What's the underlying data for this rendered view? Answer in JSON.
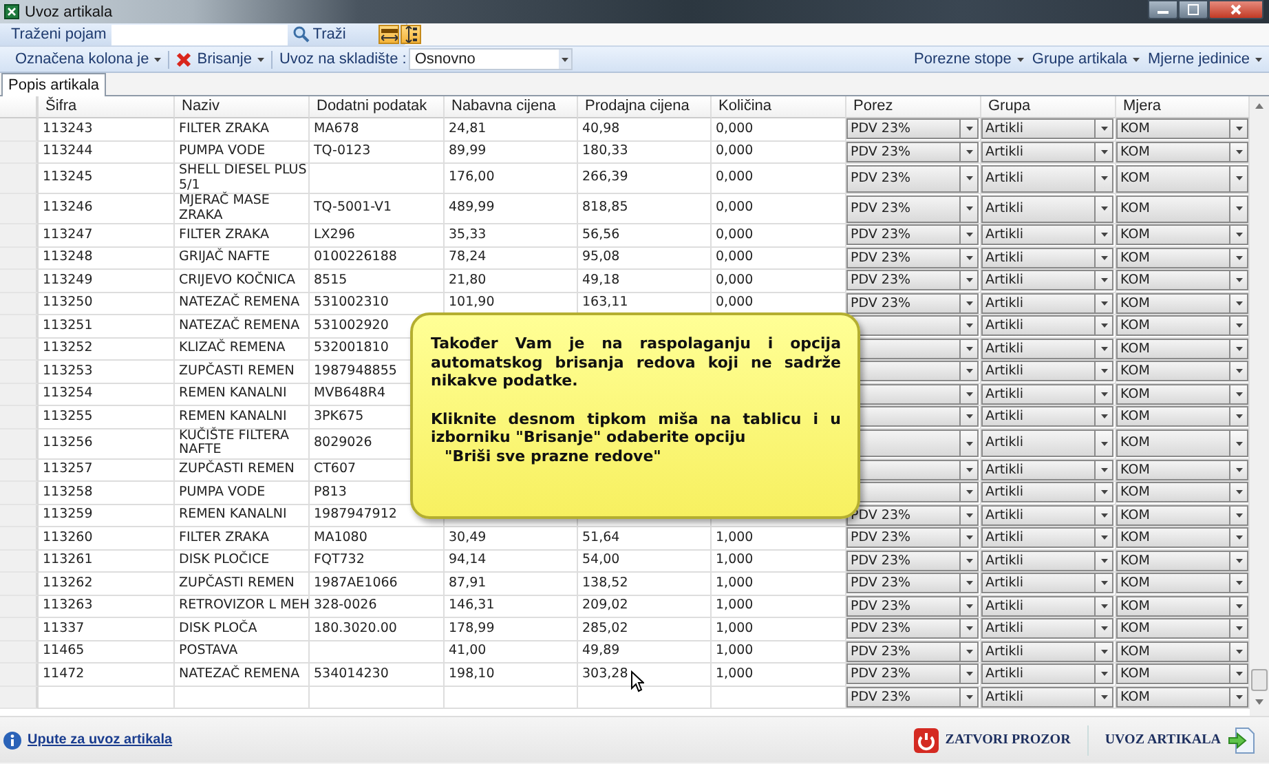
{
  "window": {
    "title": "Uvoz artikala"
  },
  "search_bar": {
    "label": "Traženi pojam",
    "button": "Traži"
  },
  "toolbar": {
    "menus": [
      "Označena kolona je",
      "Brisanje"
    ],
    "warehouse": {
      "label": "Uvoz na skladište :",
      "value": "Osnovno"
    },
    "right_menus": [
      "Porezne stope",
      "Grupe artikala",
      "Mjerne jedinice"
    ]
  },
  "tabs": [
    {
      "label": "Popis artikala",
      "selected": true
    }
  ],
  "table": {
    "columns": [
      {
        "label": "Šifra",
        "kind": "text"
      },
      {
        "label": "Naziv",
        "kind": "text"
      },
      {
        "label": "Dodatni podatak",
        "kind": "text"
      },
      {
        "label": "Nabavna cijena",
        "kind": "text"
      },
      {
        "label": "Prodajna cijena",
        "kind": "text"
      },
      {
        "label": "Količina",
        "kind": "text"
      },
      {
        "label": "Porez",
        "kind": "combo"
      },
      {
        "label": "Grupa",
        "kind": "combo"
      },
      {
        "label": "Mjera",
        "kind": "combo"
      }
    ],
    "rows": [
      {
        "sifra": "113243",
        "naziv": "FILTER ZRAKA",
        "dodatni_podatak": "MA678",
        "nabavna_cijena": "24,81",
        "prodajna_cijena": "40,98",
        "kolicina": "0,000",
        "porez": "PDV 23%",
        "grupa": "Artikli",
        "mjera": "KOM"
      },
      {
        "sifra": "113244",
        "naziv": "PUMPA VODE",
        "dodatni_podatak": "TQ-0123",
        "nabavna_cijena": "89,99",
        "prodajna_cijena": "180,33",
        "kolicina": "0,000",
        "porez": "PDV 23%",
        "grupa": "Artikli",
        "mjera": "KOM"
      },
      {
        "sifra": "113245",
        "naziv": "SHELL DIESEL PLUS\n5/1",
        "nabavna_cijena": "176,00",
        "prodajna_cijena": "266,39",
        "kolicina": "0,000",
        "porez": "PDV 23%",
        "grupa": "Artikli",
        "mjera": "KOM"
      },
      {
        "sifra": "113246",
        "naziv": "MJERAČ MASE\nZRAKA",
        "dodatni_podatak": "TQ-5001-V1",
        "nabavna_cijena": "489,99",
        "prodajna_cijena": "818,85",
        "kolicina": "0,000",
        "porez": "PDV 23%",
        "grupa": "Artikli",
        "mjera": "KOM"
      },
      {
        "sifra": "113247",
        "naziv": "FILTER ZRAKA",
        "dodatni_podatak": "LX296",
        "nabavna_cijena": "35,33",
        "prodajna_cijena": "56,56",
        "kolicina": "0,000",
        "porez": "PDV 23%",
        "grupa": "Artikli",
        "mjera": "KOM"
      },
      {
        "sifra": "113248",
        "naziv": "GRIJAČ NAFTE",
        "dodatni_podatak": "0100226188",
        "nabavna_cijena": "78,24",
        "prodajna_cijena": "95,08",
        "kolicina": "0,000",
        "porez": "PDV 23%",
        "grupa": "Artikli",
        "mjera": "KOM"
      },
      {
        "sifra": "113249",
        "naziv": "CRIJEVO KOČNICA",
        "dodatni_podatak": "8515",
        "nabavna_cijena": "21,80",
        "prodajna_cijena": "49,18",
        "kolicina": "0,000",
        "porez": "PDV 23%",
        "grupa": "Artikli",
        "mjera": "KOM"
      },
      {
        "sifra": "113250",
        "naziv": "NATEZAČ REMENA",
        "dodatni_podatak": "531002310",
        "nabavna_cijena": "101,90",
        "prodajna_cijena": "163,11",
        "kolicina": "0,000",
        "porez": "PDV 23%",
        "grupa": "Artikli",
        "mjera": "KOM"
      },
      {
        "sifra": "113251",
        "naziv": "NATEZAČ REMENA",
        "dodatni_podatak": "531002920",
        "grupa": "Artikli",
        "mjera": "KOM"
      },
      {
        "sifra": "113252",
        "naziv": "KLIZAČ REMENA",
        "dodatni_podatak": "532001810",
        "grupa": "Artikli",
        "mjera": "KOM"
      },
      {
        "sifra": "113253",
        "naziv": "ZUPČASTI REMEN",
        "dodatni_podatak": "1987948855",
        "grupa": "Artikli",
        "mjera": "KOM"
      },
      {
        "sifra": "113254",
        "naziv": "REMEN KANALNI",
        "dodatni_podatak": "MVB648R4",
        "grupa": "Artikli",
        "mjera": "KOM"
      },
      {
        "sifra": "113255",
        "naziv": "REMEN KANALNI",
        "dodatni_podatak": "3PK675",
        "grupa": "Artikli",
        "mjera": "KOM"
      },
      {
        "sifra": "113256",
        "naziv": "KUČIŠTE FILTERA\nNAFTE",
        "dodatni_podatak": "8029026",
        "grupa": "Artikli",
        "mjera": "KOM"
      },
      {
        "sifra": "113257",
        "naziv": "ZUPČASTI REMEN",
        "dodatni_podatak": "CT607",
        "grupa": "Artikli",
        "mjera": "KOM"
      },
      {
        "sifra": "113258",
        "naziv": "PUMPA VODE",
        "dodatni_podatak": "P813",
        "grupa": "Artikli",
        "mjera": "KOM"
      },
      {
        "sifra": "113259",
        "naziv": "REMEN KANALNI",
        "dodatni_podatak": "1987947912",
        "porez": "PDV 23%",
        "grupa": "Artikli",
        "mjera": "KOM"
      },
      {
        "sifra": "113260",
        "naziv": "FILTER ZRAKA",
        "dodatni_podatak": "MA1080",
        "nabavna_cijena": "30,49",
        "prodajna_cijena": "51,64",
        "kolicina": "1,000",
        "porez": "PDV 23%",
        "grupa": "Artikli",
        "mjera": "KOM"
      },
      {
        "sifra": "113261",
        "naziv": "DISK PLOČICE",
        "dodatni_podatak": "FQT732",
        "nabavna_cijena": "94,14",
        "prodajna_cijena": "54,00",
        "kolicina": "1,000",
        "porez": "PDV 23%",
        "grupa": "Artikli",
        "mjera": "KOM"
      },
      {
        "sifra": "113262",
        "naziv": "ZUPČASTI REMEN",
        "dodatni_podatak": "1987AE1066",
        "nabavna_cijena": "87,91",
        "prodajna_cijena": "138,52",
        "kolicina": "1,000",
        "porez": "PDV 23%",
        "grupa": "Artikli",
        "mjera": "KOM"
      },
      {
        "sifra": "113263",
        "naziv": "RETROVIZOR L MEH",
        "dodatni_podatak": "328-0026",
        "nabavna_cijena": "146,31",
        "prodajna_cijena": "209,02",
        "kolicina": "1,000",
        "porez": "PDV 23%",
        "grupa": "Artikli",
        "mjera": "KOM"
      },
      {
        "sifra": "11337",
        "naziv": "DISK PLOČA",
        "dodatni_podatak": "180.3020.00",
        "nabavna_cijena": "178,99",
        "prodajna_cijena": "285,02",
        "kolicina": "1,000",
        "porez": "PDV 23%",
        "grupa": "Artikli",
        "mjera": "KOM"
      },
      {
        "sifra": "11465",
        "naziv": "POSTAVA",
        "nabavna_cijena": "41,00",
        "prodajna_cijena": "49,89",
        "kolicina": "1,000",
        "porez": "PDV 23%",
        "grupa": "Artikli",
        "mjera": "KOM"
      },
      {
        "sifra": "11472",
        "naziv": "NATEZAČ REMENA",
        "dodatni_podatak": "534014230",
        "nabavna_cijena": "198,10",
        "prodajna_cijena": "303,28",
        "kolicina": "1,000",
        "porez": "PDV 23%",
        "grupa": "Artikli",
        "mjera": "KOM"
      },
      {
        "porez": "PDV 23%",
        "grupa": "Artikli",
        "mjera": "KOM"
      }
    ]
  },
  "callout": {
    "paragraphs": [
      "Također Vam je na raspolaganju i opcija automatskog brisanja redova koji ne sadrže nikakve podatke.",
      "Kliknite desnom tipkom miša na tablicu i u izborniku \"Brisanje\" odaberite opciju",
      "\"Briši sve prazne redove\""
    ]
  },
  "footer": {
    "help_link": "Upute za uvoz artikala",
    "buttons": [
      {
        "label": "ZATVORI PROZOR",
        "kind": "close"
      },
      {
        "label": "UVOZ ARTIKALA",
        "kind": "import"
      }
    ]
  }
}
